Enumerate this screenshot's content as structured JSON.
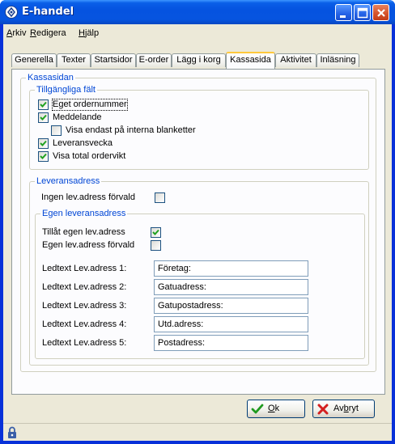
{
  "window": {
    "title": "E-handel"
  },
  "menu": [
    {
      "first": "A",
      "rest": "rkiv"
    },
    {
      "first": "R",
      "rest": "edigera"
    },
    {
      "first": "H",
      "rest": "jälp"
    }
  ],
  "tabs": [
    "Generella",
    "Texter",
    "Startsidor",
    "E-order",
    "Lägg i korg",
    "Kassasida",
    "Aktivitet",
    "Inläsning"
  ],
  "active_tab": "Kassasida",
  "panel": {
    "group_title": "Kassasidan",
    "available_fields": {
      "title": "Tillgängliga fält",
      "items": [
        {
          "label": "Eget ordernummer",
          "checked": true
        },
        {
          "label": "Meddelande",
          "checked": true
        },
        {
          "label": "Visa endast på interna blanketter",
          "checked": false
        },
        {
          "label": "Leveransvecka",
          "checked": true
        },
        {
          "label": "Visa total ordervikt",
          "checked": true
        }
      ]
    },
    "delivery": {
      "title": "Leveransadress",
      "no_default_label": "Ingen lev.adress förvald",
      "no_default_checked": false,
      "own": {
        "title": "Egen leveransadress",
        "allow_label": "Tillåt egen lev.adress",
        "allow_checked": true,
        "default_label": "Egen lev.adress förvald",
        "default_checked": false,
        "fields": [
          {
            "label": "Ledtext Lev.adress 1:",
            "value": "Företag:"
          },
          {
            "label": "Ledtext Lev.adress 2:",
            "value": "Gatuadress:"
          },
          {
            "label": "Ledtext Lev.adress 3:",
            "value": "Gatupostadress:"
          },
          {
            "label": "Ledtext Lev.adress 4:",
            "value": "Utd.adress:"
          },
          {
            "label": "Ledtext Lev.adress 5:",
            "value": "Postadress:"
          }
        ]
      }
    }
  },
  "buttons": {
    "ok": {
      "first": "O",
      "rest": "k",
      "icon": "checkmark-icon"
    },
    "cancel": {
      "first": "Av",
      "under": "b",
      "rest": "ryt",
      "icon": "x-icon"
    }
  },
  "colors": {
    "accent": "#0046d5",
    "titlebar": "#0553e0",
    "face": "#ece9d8"
  }
}
